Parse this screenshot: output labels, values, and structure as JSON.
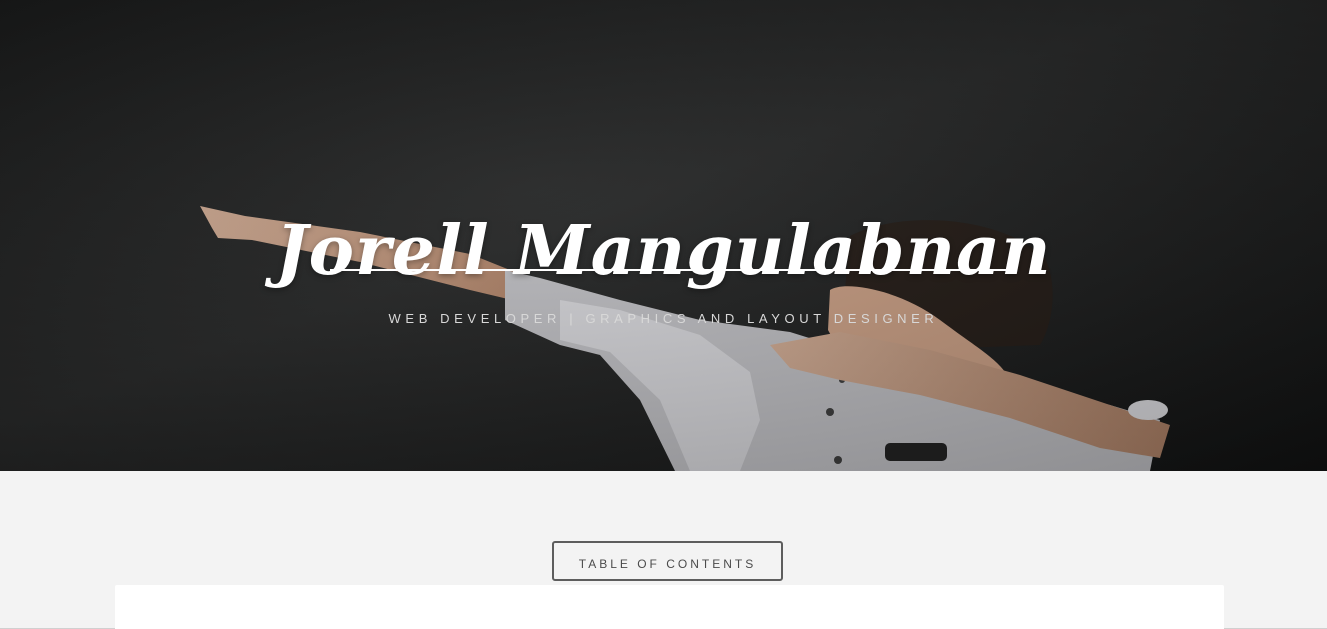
{
  "hero": {
    "title": "Jorell Mangulabnan",
    "subtitle": "WEB DEVELOPER | GRAPHICS AND LAYOUT DESIGNER"
  },
  "content": {
    "toc_button_label": "TABLE OF CONTENTS"
  },
  "colors": {
    "hero_background": "#1b1c1c",
    "page_background": "#f3f3f3",
    "card_background": "#ffffff",
    "button_border": "#5d5d5d"
  }
}
